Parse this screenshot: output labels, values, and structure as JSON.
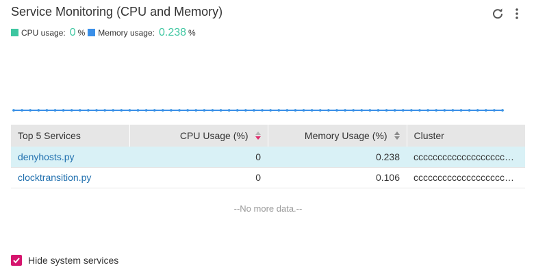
{
  "header": {
    "title": "Service Monitoring (CPU and Memory)"
  },
  "legend": {
    "cpu": {
      "label": "CPU usage:",
      "value": "0",
      "unit": "%",
      "color": "#3dc6a0"
    },
    "memory": {
      "label": "Memory usage:",
      "value": "0.238",
      "unit": "%",
      "color": "#3a8fe8"
    },
    "value_color": "#3dc6a0"
  },
  "chart_data": {
    "type": "line",
    "series": [
      {
        "values": [
          0,
          0,
          0,
          0,
          0,
          0,
          0,
          0,
          0,
          0,
          0,
          0,
          0,
          0,
          0,
          0,
          0,
          0,
          0,
          0,
          0,
          0,
          0,
          0,
          0,
          0,
          0,
          0,
          0,
          0,
          0,
          0,
          0,
          0,
          0,
          0,
          0,
          0,
          0,
          0,
          0,
          0,
          0,
          0,
          0,
          0,
          0,
          0,
          0,
          0,
          0,
          0,
          0,
          0,
          0,
          0,
          0,
          0,
          0,
          0
        ]
      },
      {
        "values": [
          0,
          0,
          0,
          0,
          0,
          0,
          0,
          0,
          0,
          0,
          0,
          0,
          0,
          0,
          0,
          0,
          0,
          0,
          0,
          0,
          0,
          0,
          0,
          0,
          0,
          0,
          0,
          0,
          0,
          0,
          0,
          0,
          0,
          0,
          0,
          0,
          0,
          0,
          0,
          0,
          0,
          0,
          0,
          0,
          0,
          0,
          0,
          0,
          0,
          0,
          0,
          0,
          0,
          0,
          0,
          0,
          0,
          0,
          0,
          0
        ]
      }
    ],
    "colors": [
      "#3dc6a0",
      "#3a8fe8"
    ]
  },
  "table": {
    "columns": [
      {
        "label": "Top 5 Services"
      },
      {
        "label": "CPU Usage (%)"
      },
      {
        "label": "Memory Usage (%)"
      },
      {
        "label": "Cluster"
      }
    ],
    "rows": [
      {
        "service": "denyhosts.py",
        "cpu": "0",
        "memory": "0.238",
        "cluster": "cccccccccccccccccccccccc"
      },
      {
        "service": "clocktransition.py",
        "cpu": "0",
        "memory": "0.106",
        "cluster": "cccccccccccccccccccccccc"
      }
    ]
  },
  "footer_text": "--No more data.--",
  "hide_system": {
    "label": "Hide system services",
    "checked": true,
    "color": "#d6156e"
  },
  "icons": [
    "refresh-icon",
    "more-vertical-icon",
    "sort-icon",
    "check-icon"
  ]
}
